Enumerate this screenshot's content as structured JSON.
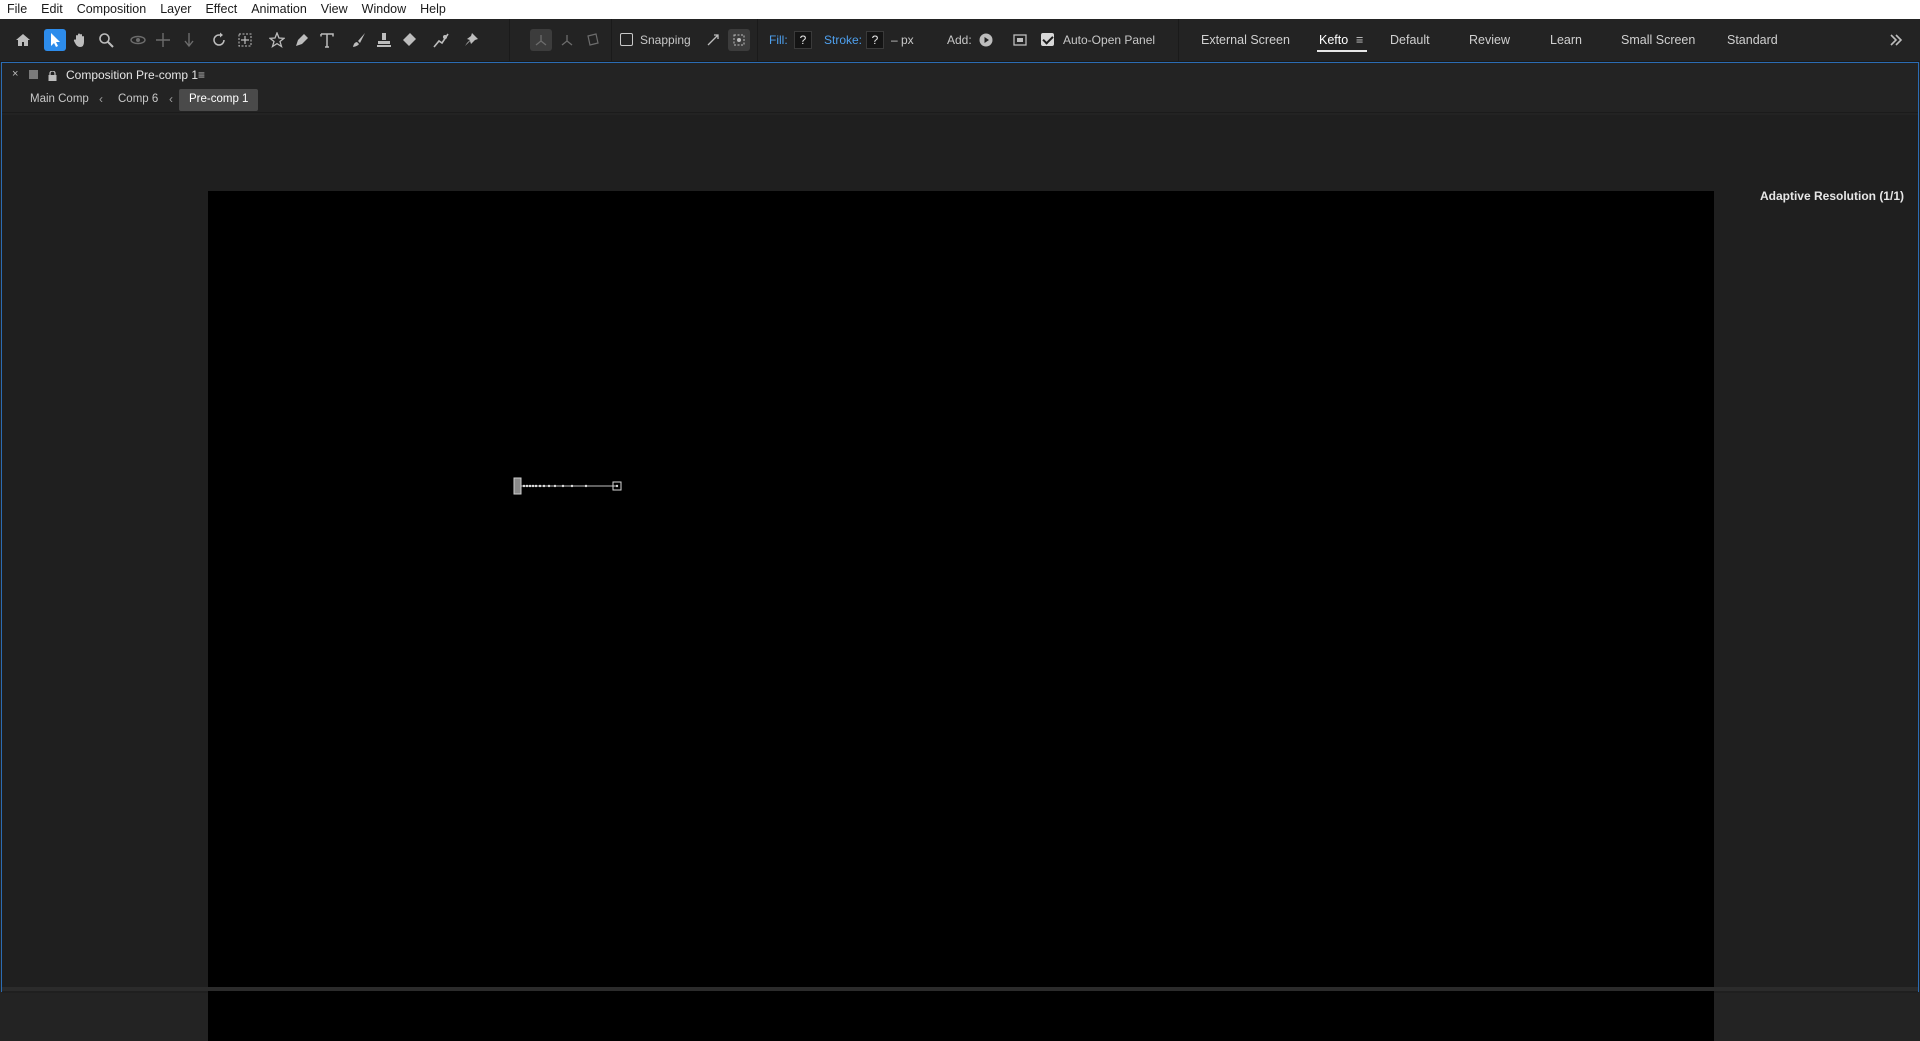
{
  "menu": [
    "File",
    "Edit",
    "Composition",
    "Layer",
    "Effect",
    "Animation",
    "View",
    "Window",
    "Help"
  ],
  "toolbar": {
    "tools": [
      "home-icon",
      "selection-tool-icon",
      "hand-tool-icon",
      "zoom-tool-icon",
      "orbit-camera-icon",
      "pan-camera-icon",
      "dolly-camera-icon",
      "rotation-tool-icon",
      "pan-behind-tool-icon",
      "shape-tool-icon",
      "pen-tool-icon",
      "type-tool-icon",
      "brush-tool-icon",
      "clone-stamp-tool-icon",
      "eraser-tool-icon",
      "roto-brush-tool-icon",
      "puppet-pin-tool-icon",
      "local-axis-icon",
      "world-axis-icon",
      "view-axis-icon"
    ],
    "snapping_label": "Snapping",
    "snapping_checked": false,
    "fill_label": "Fill:",
    "fill_value": "?",
    "stroke_label": "Stroke:",
    "stroke_value": "?",
    "stroke_units": "– px",
    "add_label": "Add:",
    "auto_open_label": "Auto-Open Panel",
    "auto_open_checked": true,
    "accent_color": "#2d8ceb"
  },
  "workspaces": {
    "items": [
      "External Screen",
      "Kefto",
      "Default",
      "Review",
      "Learn",
      "Small Screen",
      "Standard"
    ],
    "active": "Kefto",
    "overflow_icon": "chevron-double-right-icon"
  },
  "panel": {
    "close": "×",
    "title": "Composition Pre-comp 1",
    "menu_icon": "≡"
  },
  "breadcrumbs": {
    "items": [
      "Main Comp",
      "Comp 6",
      "Pre-comp 1"
    ],
    "active": "Pre-comp 1"
  },
  "viewer": {
    "adaptive_resolution": "Adaptive Resolution (1/1)",
    "canvas_color": "#000000"
  }
}
